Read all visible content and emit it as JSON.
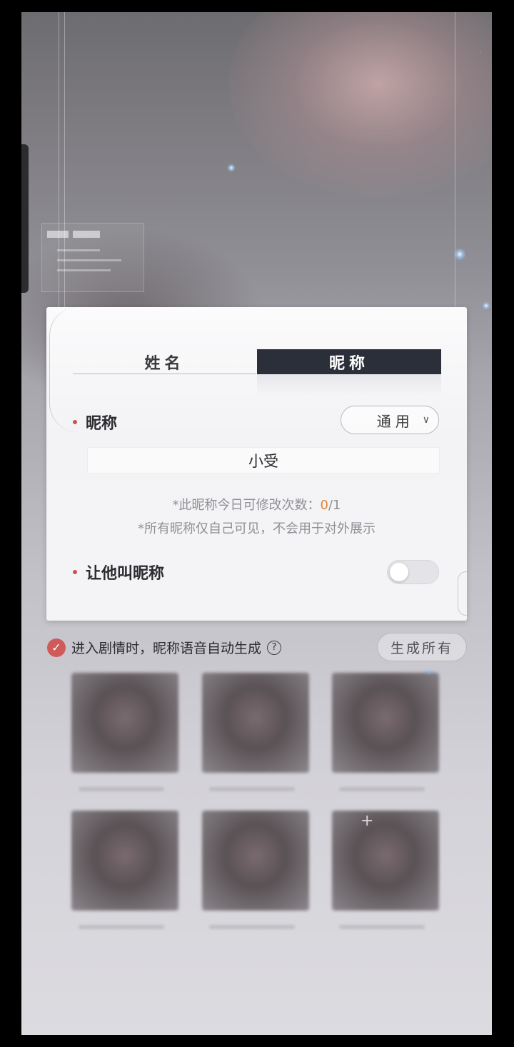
{
  "dialog": {
    "tabs": [
      {
        "label": "姓名",
        "active": false
      },
      {
        "label": "昵称",
        "active": true
      }
    ],
    "nickname_label": "昵称",
    "scope_select": {
      "value": "通用",
      "chevron": "chevron-down-icon"
    },
    "nickname_value": "小受",
    "note_limit_prefix": "*此昵称今日可修改次数：",
    "note_limit_used": "0",
    "note_limit_total": "/1",
    "note_private": "*所有昵称仅自己可见，不会用于对外展示",
    "call_nickname_label": "让他叫昵称",
    "call_nickname_enabled": false
  },
  "auto_voice": {
    "checked": true,
    "label": "进入剧情时，昵称语音自动生成",
    "help_icon": "?"
  },
  "generate_all_label": "生成所有",
  "colors": {
    "active_tab_bg": "#2a2f39",
    "accent_dot": "#c8554a",
    "highlight_count": "#e1862f",
    "check_red": "#cf5a5a"
  }
}
